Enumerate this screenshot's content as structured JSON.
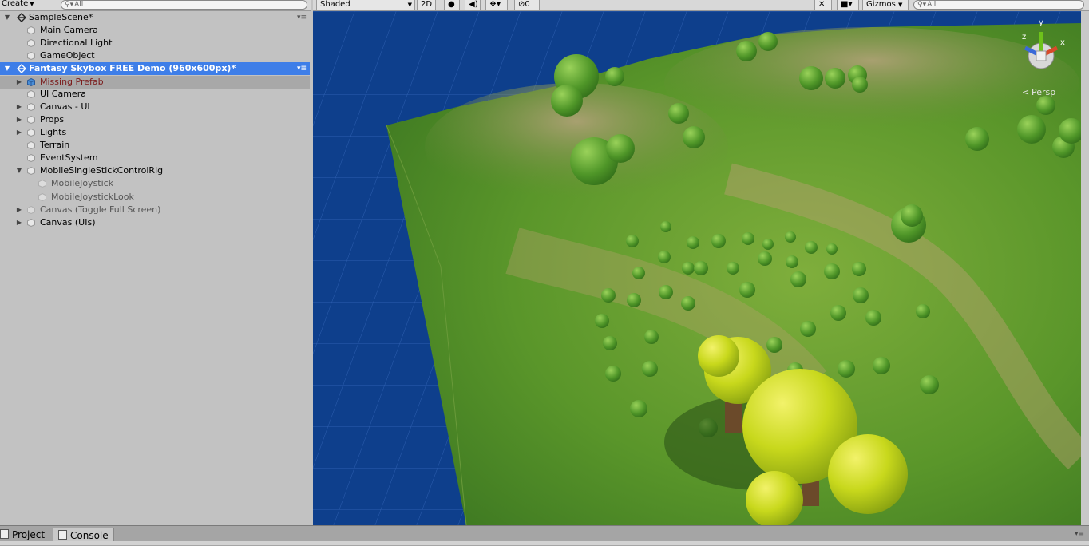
{
  "hierarchy": {
    "create_label": "Create",
    "search_placeholder": "All",
    "scenes": [
      {
        "name": "SampleScene*",
        "children": [
          "Main Camera",
          "Directional Light",
          "GameObject"
        ]
      },
      {
        "name": "Fantasy Skybox FREE Demo (960x600px)*",
        "children": [
          "Missing Prefab",
          "UI Camera",
          "Canvas - UI",
          "Props",
          "Lights",
          "Terrain",
          "EventSystem",
          "MobileSingleStickControlRig",
          "MobileJoystick",
          "MobileJoystickLook",
          "Canvas (Toggle Full Screen)",
          "Canvas (UIs)"
        ]
      }
    ]
  },
  "scene_toolbar": {
    "shading_mode": "Shaded",
    "mode_2d": "2D",
    "hidden_count": "0",
    "gizmos_label": "Gizmos",
    "search_placeholder": "All"
  },
  "scene_view": {
    "gizmo_axes": {
      "y": "y",
      "z": "z",
      "x": "x"
    },
    "projection_label": "Persp",
    "colors": {
      "background": "#0e3f8c",
      "grass": "#5a9a2c",
      "tree_yellow": "#c9d81a",
      "tree_green": "#5aa92c"
    }
  },
  "bottom_tabs": [
    {
      "label": "Project"
    },
    {
      "label": "Console"
    }
  ]
}
